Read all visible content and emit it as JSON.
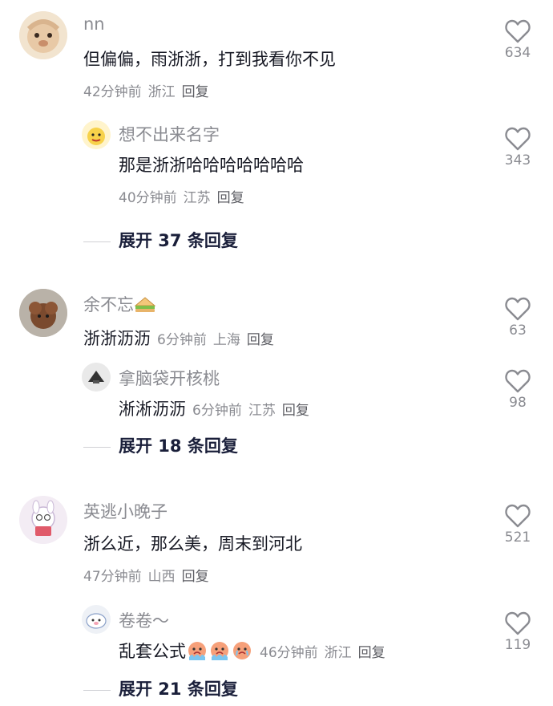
{
  "comments": [
    {
      "user": "nn",
      "text": "但偏偏，雨浙浙，打到我看你不见",
      "time": "42分钟前",
      "location": "浙江",
      "reply": "回复",
      "likes": "634",
      "replies": [
        {
          "user": "想不出来名字",
          "text": "那是浙浙哈哈哈哈哈哈哈",
          "time": "40分钟前",
          "location": "江苏",
          "reply": "回复",
          "likes": "343"
        }
      ],
      "expand": "展开 37 条回复"
    },
    {
      "user": "余不忘",
      "user_emoji": "sandwich-emoji",
      "text": "浙浙沥沥",
      "time": "6分钟前",
      "location": "上海",
      "reply": "回复",
      "likes": "63",
      "replies": [
        {
          "user": "拿脑袋开核桃",
          "text": "淅淅沥沥",
          "time": "6分钟前",
          "location": "江苏",
          "reply": "回复",
          "likes": "98"
        }
      ],
      "expand": "展开 18 条回复"
    },
    {
      "user": "英逃小晚子",
      "text": "浙么近，那么美，周末到河北",
      "time": "47分钟前",
      "location": "山西",
      "reply": "回复",
      "likes": "521",
      "replies": [
        {
          "user": "卷卷～",
          "text": "乱套公式",
          "text_emojis": [
            "crying-face-emoji",
            "crying-face-emoji",
            "crying-face-emoji"
          ],
          "time": "46分钟前",
          "location": "浙江",
          "reply": "回复",
          "likes": "119"
        }
      ],
      "expand": "展开 21 条回复"
    }
  ],
  "colors": {
    "muted": "#8a8b91",
    "text": "#161823",
    "expand": "#1a1f3a"
  },
  "icons": {
    "like": "heart-outline-icon"
  }
}
